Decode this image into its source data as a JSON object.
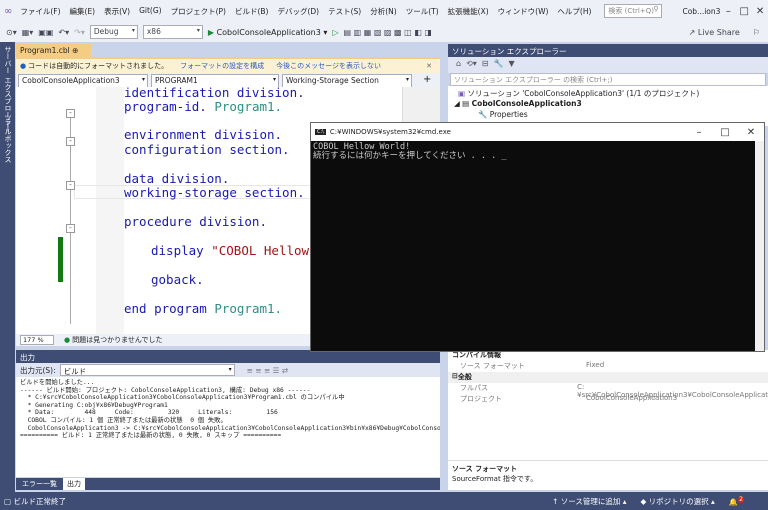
{
  "menu": [
    "ファイル(F)",
    "編集(E)",
    "表示(V)",
    "Git(G)",
    "プロジェクト(P)",
    "ビルド(B)",
    "デバッグ(D)",
    "テスト(S)",
    "分析(N)",
    "ツール(T)",
    "拡張機能(X)",
    "ウィンドウ(W)",
    "ヘルプ(H)"
  ],
  "search_placeholder": "検索 (Ctrl+Q)",
  "window_title": "Cob...ion3",
  "toolbar": {
    "config": "Debug",
    "platform": "x86",
    "run_label": "CobolConsoleApplication3",
    "live_share": "Live Share"
  },
  "left_tabs": [
    "サーバー エクスプローラー",
    "ツールボックス"
  ],
  "doc_tab": "Program1.cbl",
  "infobar": {
    "message": "コードは自動的にフォーマットされました。",
    "link1": "フォーマットの設定を構成",
    "link2": "今後このメッセージを表示しない"
  },
  "nav": {
    "project": "CobolConsoleApplication3",
    "program": "PROGRAM1",
    "section": "Working-Storage Section"
  },
  "code": {
    "l1": "identification division.",
    "l2a": "program-id. ",
    "l2b": "Program1.",
    "l3": "environment division.",
    "l4": "configuration section.",
    "l5": "data division.",
    "l6": "working-storage section.",
    "l7": "procedure division.",
    "l8a": "display ",
    "l8b": "\"COBOL Hellow World!\".",
    "l9": "goback.",
    "l10a": "end program ",
    "l10b": "Program1."
  },
  "editor_status": {
    "zoom": "177 %",
    "issues": "問題は見つかりませんでした"
  },
  "output": {
    "title": "出力",
    "source_label": "出力元(S):",
    "source": "ビルド",
    "lines": [
      "ビルドを開始しました...",
      "------ ビルド開始: プロジェクト: CobolConsoleApplication3, 構成: Debug x86 ------",
      "  * C:¥src¥CobolConsoleApplication3¥CobolConsoleApplication3¥Program1.cbl のコンパイル中",
      "  * Generating C:obj¥x86¥Debug¥Program1",
      "  * Data:        448     Code:         320     Literals:         156",
      "  COBOL コンパイル: 1 個 正常終了または最新の状態  0 個 失敗。",
      "  CobolConsoleApplication3 -> C:¥src¥CobolConsoleApplication3¥CobolConsoleApplication3¥bin¥x86¥Debug¥CobolConsoleApp",
      "========== ビルド: 1 正常終了または最新の状態, 0 失敗, 0 スキップ =========="
    ],
    "tabs": [
      "エラー一覧",
      "出力"
    ]
  },
  "status": {
    "left": "ビルド正常終了",
    "add_source": "ソース管理に追加",
    "repo": "リポジトリの選択",
    "notifications": "2"
  },
  "solution": {
    "title": "ソリューション エクスプローラー",
    "search": "ソリューション エクスプローラー の検索 (Ctrl+;)",
    "root": "ソリューション 'CobolConsoleApplication3' (1/1 のプロジェクト)",
    "project": "CobolConsoleApplication3",
    "properties": "Properties"
  },
  "props": {
    "cat1": "コンパイル情報",
    "r1k": "ソース フォーマット",
    "r1v": "Fixed",
    "cat2": "全般",
    "r2k": "フルパス",
    "r2v": "C:¥src¥CobolConsoleApplication3¥CobolConsoleApplicat",
    "r3k": "プロジェクト",
    "r3v": "CobolConsoleApplication3",
    "desc_title": "ソース フォーマット",
    "desc": "SourceFormat 指令です。"
  },
  "cmd": {
    "title": "C:¥WINDOWS¥system32¥cmd.exe",
    "line1": "COBOL Hellow World!",
    "line2": "続行するには何かキーを押してください . . . _"
  }
}
